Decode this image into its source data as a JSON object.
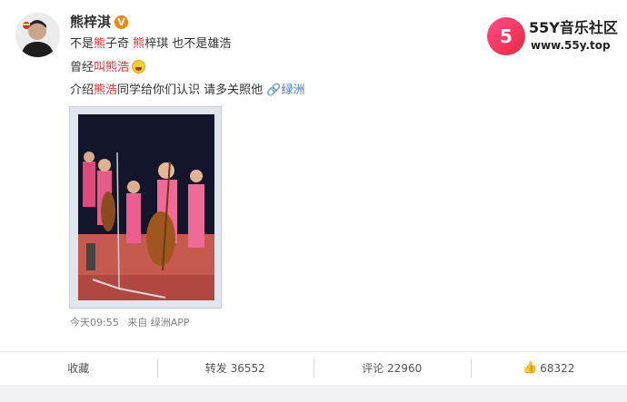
{
  "post": {
    "username": "熊梓淇",
    "verified_badge": "V",
    "line1": {
      "a": "不是",
      "b": "熊",
      "c": "子奇 ",
      "d": "熊",
      "e": "梓琪 也不是雄浩"
    },
    "line2": {
      "a": "曾经",
      "b": "叫熊浩"
    },
    "line3": {
      "a": "介绍",
      "b": "熊浩",
      "c": "同学给你们认识 请多关照他 ",
      "link_icon": "🔗",
      "d": "绿洲"
    },
    "timestamp": "今天09:55",
    "source_prefix": "来自",
    "source": "绿洲APP"
  },
  "watermark": {
    "logo_text": "5",
    "title": "55Y音乐社区",
    "url": "www.55y.top"
  },
  "actions": {
    "favorite": "收藏",
    "repost": "转发 36552",
    "comment": "评论 22960",
    "like_icon": "👍",
    "like": "68322"
  },
  "icons": {
    "avatar": "avatar-photo",
    "emoji": "laughing-emoji-icon",
    "like": "thumbs-up-icon"
  },
  "colors": {
    "highlight_red": "#e8312e",
    "link_orange": "#eb7350",
    "link_blue": "#3f7fd2",
    "badge_orange": "#ff8200"
  }
}
